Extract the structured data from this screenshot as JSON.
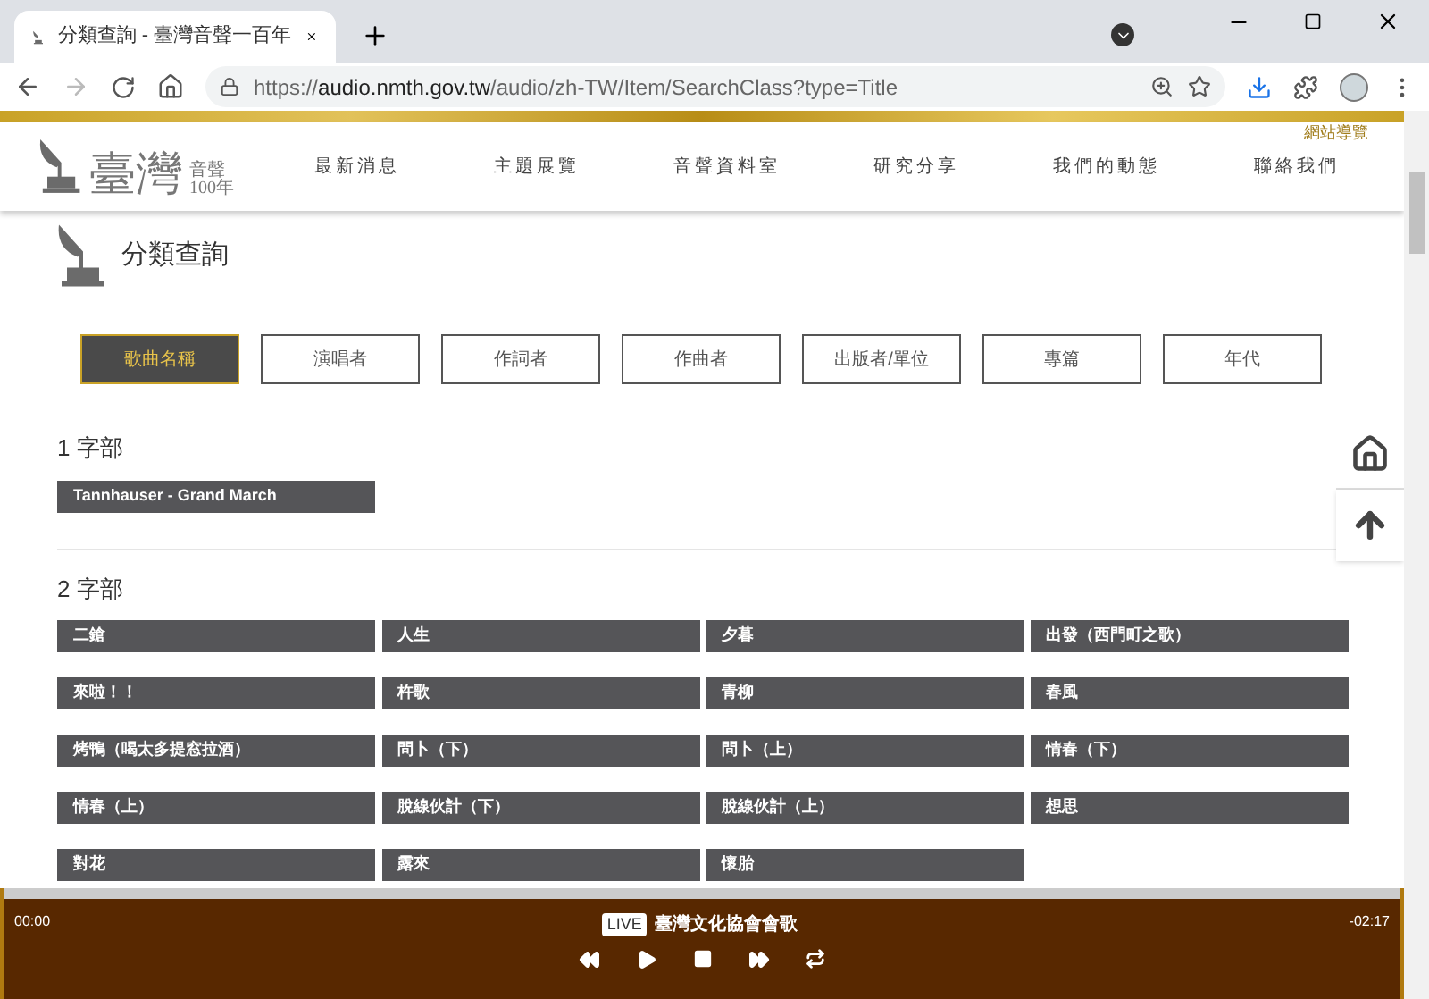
{
  "browser": {
    "tab_title": "分類查詢 - 臺灣音聲一百年",
    "url_host": "audio.nmth.gov.tw",
    "url_prefix": "https://",
    "url_path": "/audio/zh-TW/Item/SearchClass?type=Title"
  },
  "site": {
    "sitemap_link": "網站導覽",
    "logo": {
      "main": "臺灣",
      "sub": "音聲",
      "year": "100年"
    },
    "nav": [
      "最新消息",
      "主題展覽",
      "音聲資料室",
      "研究分享",
      "我們的動態",
      "聯絡我們"
    ]
  },
  "page_title": "分類查詢",
  "categories": [
    {
      "label": "歌曲名稱",
      "selected": true
    },
    {
      "label": "演唱者",
      "selected": false
    },
    {
      "label": "作詞者",
      "selected": false
    },
    {
      "label": "作曲者",
      "selected": false
    },
    {
      "label": "出版者/單位",
      "selected": false
    },
    {
      "label": "專篇",
      "selected": false
    },
    {
      "label": "年代",
      "selected": false
    }
  ],
  "sections": [
    {
      "heading": "1 字部",
      "items": [
        "Tannhauser - Grand March"
      ]
    },
    {
      "heading": "2 字部",
      "items": [
        "二鎗",
        "人生",
        "夕暮",
        "出發（西門町之歌）",
        "來啦！！",
        "杵歌",
        "青柳",
        "春風",
        "烤鴨（喝太多提窓拉酒）",
        "問卜（下）",
        "問卜（上）",
        "情春（下）",
        "情春（上）",
        "脫線伙計（下）",
        "脫線伙計（上）",
        "想思",
        "對花",
        "露來",
        "懷胎"
      ]
    }
  ],
  "player": {
    "elapsed": "00:00",
    "remaining": "-02:17",
    "badge": "LIVE",
    "title": "臺灣文化協會會歌"
  }
}
